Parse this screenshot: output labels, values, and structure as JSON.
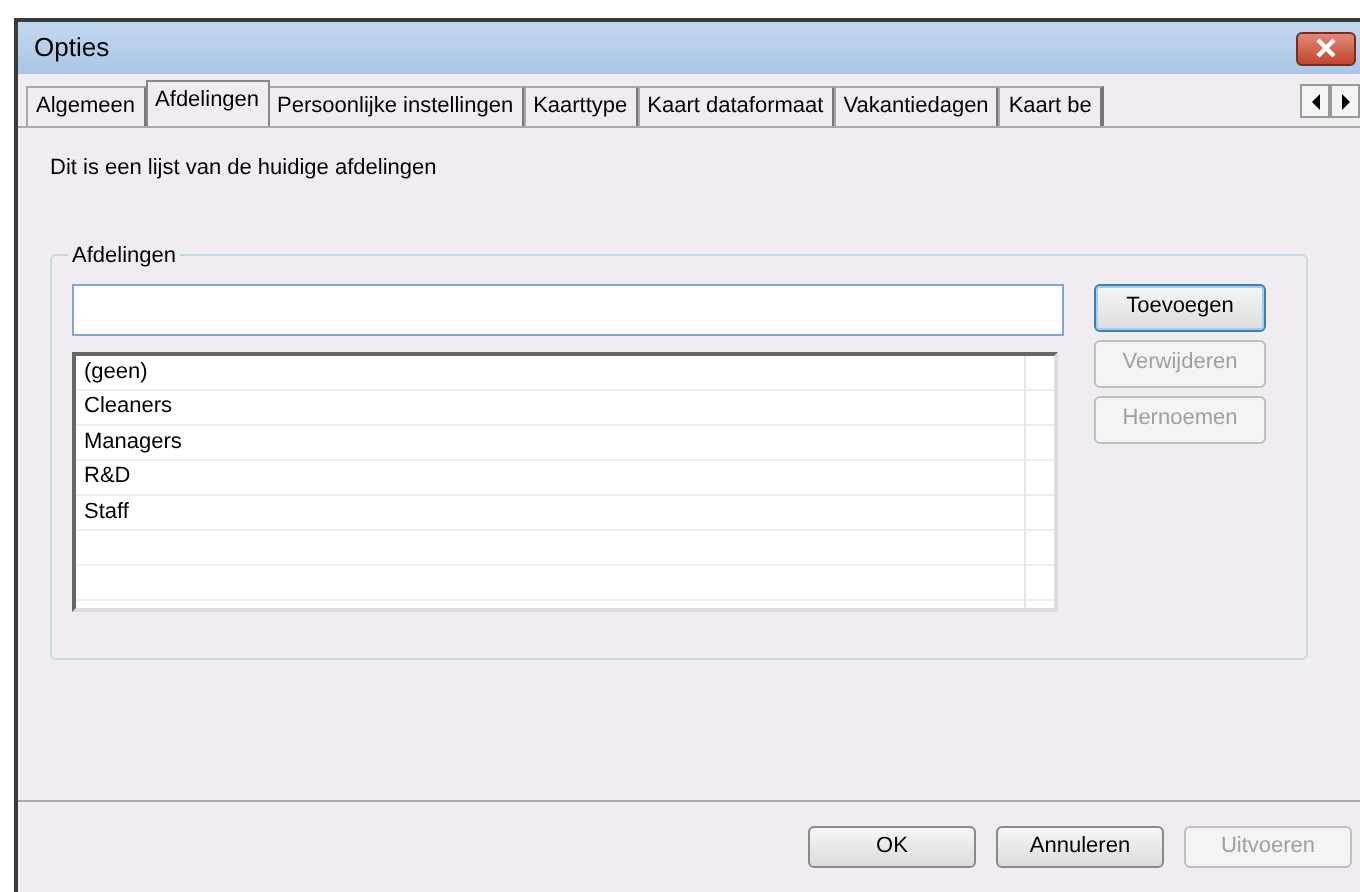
{
  "window": {
    "title": "Opties"
  },
  "tabs": [
    {
      "label": "Algemeen",
      "selected": false
    },
    {
      "label": "Afdelingen",
      "selected": true
    },
    {
      "label": "Persoonlijke instellingen",
      "selected": false
    },
    {
      "label": "Kaarttype",
      "selected": false
    },
    {
      "label": "Kaart dataformaat",
      "selected": false
    },
    {
      "label": "Vakantiedagen",
      "selected": false
    },
    {
      "label": "Kaart be",
      "selected": false
    }
  ],
  "description": "Dit is een lijst van de huidige afdelingen",
  "group": {
    "title": "Afdelingen",
    "items": [
      "(geen)",
      "Cleaners",
      "Managers",
      "R&D",
      "Staff"
    ],
    "buttons": [
      {
        "label": "Toevoegen",
        "disabled": false,
        "default": true
      },
      {
        "label": "Verwijderen",
        "disabled": true,
        "default": false
      },
      {
        "label": "Hernoemen",
        "disabled": true,
        "default": false
      }
    ]
  },
  "footer_buttons": [
    {
      "label": "OK",
      "disabled": false
    },
    {
      "label": "Annuleren",
      "disabled": false
    },
    {
      "label": "Uitvoeren",
      "disabled": true
    }
  ]
}
